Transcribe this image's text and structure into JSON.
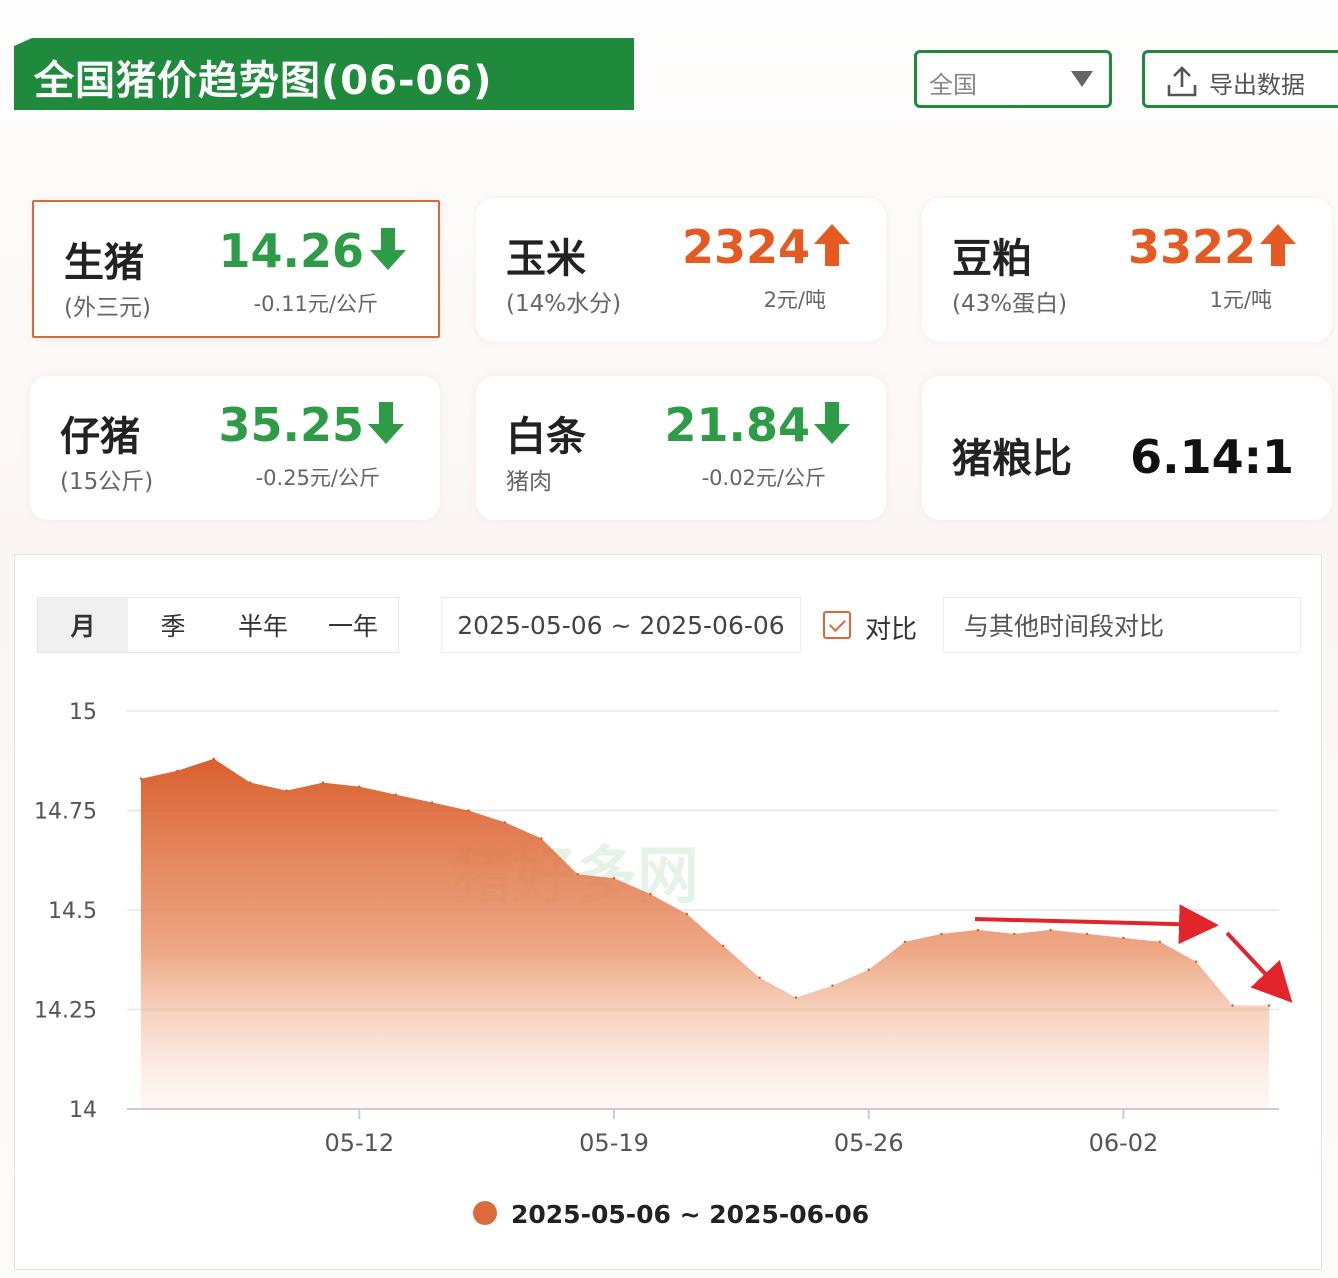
{
  "header": {
    "title": "全国猪价趋势图(06-06)",
    "region": "全国",
    "export_label": "导出数据"
  },
  "cards": [
    {
      "name": "生猪",
      "sub": "(外三元)",
      "value": "14.26",
      "change": "-0.11元/公斤",
      "direction": "down"
    },
    {
      "name": "玉米",
      "sub": "(14%水分)",
      "value": "2324",
      "change": "2元/吨",
      "direction": "up"
    },
    {
      "name": "豆粕",
      "sub": "(43%蛋白)",
      "value": "3322",
      "change": "1元/吨",
      "direction": "up"
    },
    {
      "name": "仔猪",
      "sub": "(15公斤)",
      "value": "35.25",
      "change": "-0.25元/公斤",
      "direction": "down"
    },
    {
      "name": "白条",
      "sub": "猪肉",
      "value": "21.84",
      "change": "-0.02元/公斤",
      "direction": "down"
    },
    {
      "name": "猪粮比",
      "sub": "",
      "value": "6.14:1",
      "change": "",
      "direction": "none"
    }
  ],
  "controls": {
    "tabs": [
      "月",
      "季",
      "半年",
      "一年"
    ],
    "active_tab": "月",
    "date_range": "2025-05-06 ~ 2025-06-06",
    "compare_label": "对比",
    "compare_placeholder": "与其他时间段对比"
  },
  "watermark": "猪好多网",
  "colors": {
    "accent": "#1f8a3c",
    "up": "#e45a22",
    "down": "#2e9b46",
    "area": "#dc6a3c"
  },
  "chart_data": {
    "type": "area",
    "x": [
      "05-06",
      "05-07",
      "05-08",
      "05-09",
      "05-10",
      "05-11",
      "05-12",
      "05-13",
      "05-14",
      "05-15",
      "05-16",
      "05-17",
      "05-18",
      "05-19",
      "05-20",
      "05-21",
      "05-22",
      "05-23",
      "05-24",
      "05-25",
      "05-26",
      "05-27",
      "05-28",
      "05-29",
      "05-30",
      "05-31",
      "06-01",
      "06-02",
      "06-03",
      "06-04",
      "06-05",
      "06-06"
    ],
    "series": [
      {
        "name": "2025-05-06 ~ 2025-06-06",
        "values": [
          14.83,
          14.85,
          14.88,
          14.82,
          14.8,
          14.82,
          14.81,
          14.79,
          14.77,
          14.75,
          14.72,
          14.68,
          14.59,
          14.58,
          14.54,
          14.49,
          14.41,
          14.33,
          14.28,
          14.31,
          14.35,
          14.42,
          14.44,
          14.45,
          14.44,
          14.45,
          14.44,
          14.43,
          14.42,
          14.37,
          14.26,
          14.26
        ]
      }
    ],
    "x_ticks": [
      "05-12",
      "05-19",
      "05-26",
      "06-02"
    ],
    "y_ticks": [
      "15",
      "14.75",
      "14.5",
      "14.25",
      "14"
    ],
    "ylim": [
      14,
      15
    ],
    "grid": true,
    "legend_position": "bottom"
  }
}
